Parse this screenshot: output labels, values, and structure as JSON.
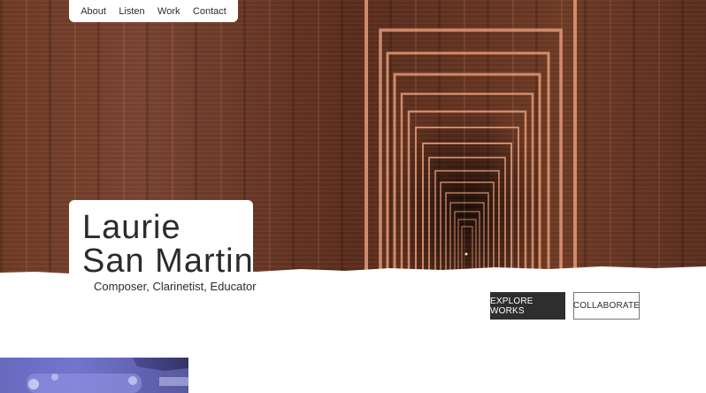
{
  "nav": {
    "items": [
      "About",
      "Listen",
      "Work",
      "Contact"
    ]
  },
  "hero": {
    "title_line1": "Laurie",
    "title_line2": "San Martin",
    "tagline": "Composer, Clarinetist, Educator"
  },
  "actions": {
    "explore_label": "EXPLORE WORKS",
    "collaborate_label": "COLLABORATE"
  },
  "colors": {
    "hero_brown": "#6e3a24",
    "frame_glow": "#e39a78",
    "dark_button": "#2e2e2e",
    "photo_blue": "#6b6cc4"
  }
}
